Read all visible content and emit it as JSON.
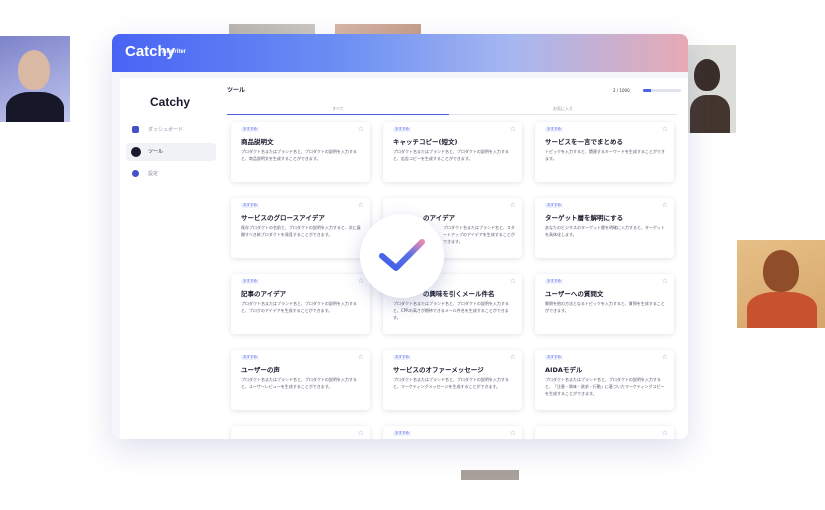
{
  "app": {
    "brand": "Catchy",
    "brand_sub": "AI writer",
    "sidebar": {
      "logo": "Catchy",
      "items": [
        {
          "label": "ダッシュボード",
          "icon": "dashboard-icon"
        },
        {
          "label": "ツール",
          "icon": "tool-icon"
        },
        {
          "label": "設定",
          "icon": "settings-icon"
        }
      ]
    },
    "main": {
      "title": "ツール",
      "usage_text": "2 / 1000",
      "usage_progress": 0.2,
      "tabs": [
        "すべて",
        "お気に入り"
      ]
    },
    "cards": [
      {
        "badge": "おすすめ",
        "title": "商品説明文",
        "desc": "プロダクト名またはブランド名と、プロダクトの説明を入力すると、商品説明文を生成することができます。"
      },
      {
        "badge": "おすすめ",
        "title": "キャッチコピー(短文)",
        "desc": "プロダクト名またはブランド名と、プロダクトの説明を入力すると、広告コピーを生成することができます。"
      },
      {
        "badge": "おすすめ",
        "title": "サービスを一言でまとめる",
        "desc": "トピックを入力すると、関連するキーワードを生成することができます。"
      },
      {
        "badge": "おすすめ",
        "title": "サービスのグロースアイデア",
        "desc": "既存プロダクトの名前と、プロダクトの説明を入力すると、次に展開すべき新プロダクトを発見することができます。"
      },
      {
        "badge": "",
        "title": "のアイデア",
        "desc": "プロダクト名またはブランド名と、スタートアップのアイデアを生成することができます。"
      },
      {
        "badge": "おすすめ",
        "title": "ターゲット層を解明にする",
        "desc": "あなたのビジネスのターゲット層を明確に入力すると、ターゲットを具体化します。"
      },
      {
        "badge": "おすすめ",
        "title": "記事のアイデア",
        "desc": "プロダクト名またはブランド名と、プロダクトの説明を入力すると、ブログのアイデアを生成することができます。"
      },
      {
        "badge": "",
        "title": "の興味を引くメール件名",
        "desc": "プロダクト名またはブランド名と、プロダクトの説明を入力すると、CPRの高さが期待できるメール件名を生成することができます。"
      },
      {
        "badge": "おすすめ",
        "title": "ユーザーへの質問文",
        "desc": "質問を他の方法となるトピックを入力すると、質問を生成することができます。"
      },
      {
        "badge": "おすすめ",
        "title": "ユーザーの声",
        "desc": "プロダクト名またはブランド名と、プロダクトの説明を入力すると、ユーザーレビューを生成することができます。"
      },
      {
        "badge": "おすすめ",
        "title": "サービスのオファーメッセージ",
        "desc": "プロダクト名またはブランド名と、プロダクトの説明を入力すると、マーケティングメッセージを生成することができます。"
      },
      {
        "badge": "おすすめ",
        "title": "AIDAモデル",
        "desc": "プロダクト名またはブランド名と、プロダクトの説明を入力すると、「注意・興味・欲求・行動」に基づいたマーケティングコピーを生成することができます。"
      },
      {
        "badge": "",
        "title": "",
        "desc": ""
      },
      {
        "badge": "おすすめ",
        "title": "",
        "desc": ""
      },
      {
        "badge": "",
        "title": "",
        "desc": ""
      }
    ]
  },
  "colors": {
    "accent": "#4c63e8",
    "gradient_start": "#4864f4",
    "gradient_end": "#e7a9b4",
    "check_left": "#3f5de6",
    "check_right": "#e38bb0"
  },
  "icons": {
    "star": "☆",
    "check": "check-mark-icon"
  }
}
